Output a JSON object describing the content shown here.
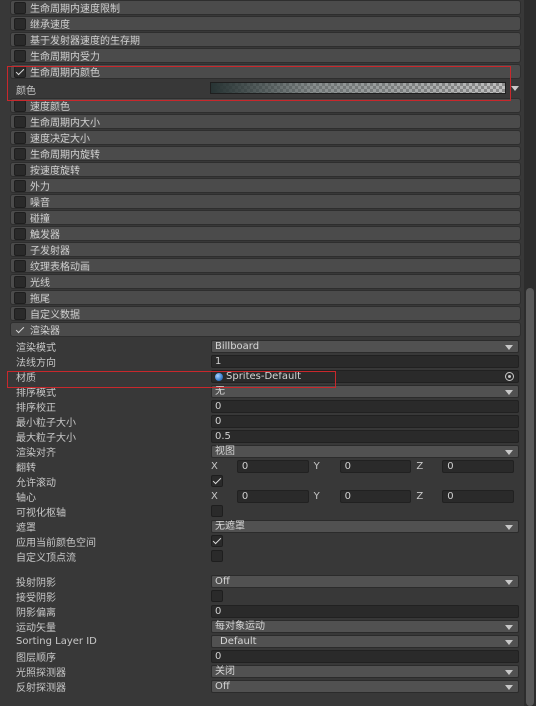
{
  "modules": [
    {
      "label": "生命周期内速度限制",
      "checked": false
    },
    {
      "label": "继承速度",
      "checked": false
    },
    {
      "label": "基于发射器速度的生存期",
      "checked": false
    },
    {
      "label": "生命周期内受力",
      "checked": false
    },
    {
      "label": "生命周期内颜色",
      "checked": true
    }
  ],
  "color_module": {
    "color_label": "颜色"
  },
  "modules2": [
    {
      "label": "速度颜色",
      "checked": false
    },
    {
      "label": "生命周期内大小",
      "checked": false
    },
    {
      "label": "速度决定大小",
      "checked": false
    },
    {
      "label": "生命周期内旋转",
      "checked": false
    },
    {
      "label": "按速度旋转",
      "checked": false
    },
    {
      "label": "外力",
      "checked": false
    },
    {
      "label": "噪音",
      "checked": false
    },
    {
      "label": "碰撞",
      "checked": false
    },
    {
      "label": "触发器",
      "checked": false
    },
    {
      "label": "子发射器",
      "checked": false
    },
    {
      "label": "纹理表格动画",
      "checked": false
    },
    {
      "label": "光线",
      "checked": false
    },
    {
      "label": "拖尾",
      "checked": false
    },
    {
      "label": "自定义数据",
      "checked": false
    },
    {
      "label": "渲染器",
      "checked": true
    }
  ],
  "renderer": {
    "render_mode": {
      "label": "渲染模式",
      "value": "Billboard"
    },
    "normal_direction": {
      "label": "法线方向",
      "value": "1"
    },
    "material": {
      "label": "材质",
      "value": "Sprites-Default"
    },
    "sort_mode": {
      "label": "排序模式",
      "value": "无"
    },
    "sorting_fudge": {
      "label": "排序校正",
      "value": "0"
    },
    "min_particle_size": {
      "label": "最小粒子大小",
      "value": "0"
    },
    "max_particle_size": {
      "label": "最大粒子大小",
      "value": "0.5"
    },
    "render_alignment": {
      "label": "渲染对齐",
      "value": "视图"
    },
    "flip": {
      "label": "翻转",
      "x_label": "X",
      "x": "0",
      "y_label": "Y",
      "y": "0",
      "z_label": "Z",
      "z": "0"
    },
    "allow_roll": {
      "label": "允许滚动",
      "checked": true
    },
    "pivot": {
      "label": "轴心",
      "x_label": "X",
      "x": "0",
      "y_label": "Y",
      "y": "0",
      "z_label": "Z",
      "z": "0"
    },
    "visualize_pivot": {
      "label": "可视化枢轴",
      "checked": false
    },
    "masking": {
      "label": "遮罩",
      "value": "无遮罩"
    },
    "apply_active_color_space": {
      "label": "应用当前颜色空间",
      "checked": true
    },
    "custom_vertex_streams": {
      "label": "自定义顶点流",
      "checked": false
    },
    "cast_shadows": {
      "label": "投射阴影",
      "value": "Off"
    },
    "receive_shadows": {
      "label": "接受阴影",
      "checked": false
    },
    "shadow_bias": {
      "label": "阴影偏离",
      "value": "0"
    },
    "motion_vectors": {
      "label": "运动矢量",
      "value": "每对象运动"
    },
    "sorting_layer": {
      "label": "Sorting Layer ID",
      "value": "Default"
    },
    "order_in_layer": {
      "label": "图层顺序",
      "value": "0"
    },
    "light_probes": {
      "label": "光照探测器",
      "value": "关闭"
    },
    "reflection_probes": {
      "label": "反射探测器",
      "value": "Off"
    }
  }
}
